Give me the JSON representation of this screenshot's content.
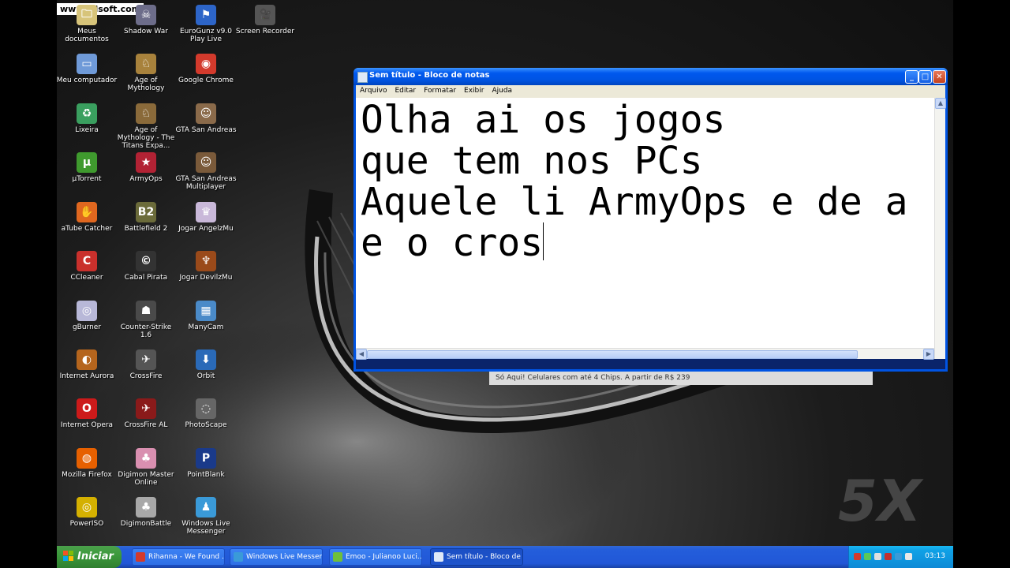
{
  "watermark": "www.zdsoft.com",
  "desktop_icons": [
    {
      "label": "Meus documentos",
      "icon": "my-documents-icon",
      "color": "#d7c47a",
      "glyph": "🗀"
    },
    {
      "label": "Shadow War",
      "icon": "shadow-war-icon",
      "color": "#6d6d8a",
      "glyph": "☠"
    },
    {
      "label": "EuroGunz v9.0 Play Live",
      "icon": "eurogunz-icon",
      "color": "#2d65c8",
      "glyph": "⚑"
    },
    {
      "label": "Screen Recorder",
      "icon": "screen-recorder-icon",
      "color": "#555555",
      "glyph": "🎥"
    },
    {
      "label": "Meu computador",
      "icon": "my-computer-icon",
      "color": "#6f9ad8",
      "glyph": "▭"
    },
    {
      "label": "Age of Mythology",
      "icon": "age-of-mythology-icon",
      "color": "#a8823c",
      "glyph": "♘"
    },
    {
      "label": "Google Chrome",
      "icon": "chrome-icon",
      "color": "#d33a2c",
      "glyph": "◉"
    },
    {
      "label": "Lixeira",
      "icon": "recycle-bin-icon",
      "color": "#3a9f5f",
      "glyph": "♻"
    },
    {
      "label": "Age of Mythology - The Titans Expa...",
      "icon": "age-of-mythology-titans-icon",
      "color": "#8a6a3a",
      "glyph": "♘"
    },
    {
      "label": "GTA San Andreas",
      "icon": "gta-sa-icon",
      "color": "#8a6a4a",
      "glyph": "☺"
    },
    {
      "label": "µTorrent",
      "icon": "utorrent-icon",
      "color": "#3f9a2e",
      "glyph": "µ"
    },
    {
      "label": "ArmyOps",
      "icon": "armyops-icon",
      "color": "#b22234",
      "glyph": "★"
    },
    {
      "label": "GTA San Andreas Multiplayer",
      "icon": "gta-samp-icon",
      "color": "#7a5a3a",
      "glyph": "☺"
    },
    {
      "label": "aTube Catcher",
      "icon": "atube-catcher-icon",
      "color": "#e0671f",
      "glyph": "✋"
    },
    {
      "label": "Battlefield 2",
      "icon": "battlefield2-icon",
      "color": "#6b6b3a",
      "glyph": "B2"
    },
    {
      "label": "Jogar AngelzMu",
      "icon": "angelzmu-icon",
      "color": "#c9b8d9",
      "glyph": "♛"
    },
    {
      "label": "CCleaner",
      "icon": "ccleaner-icon",
      "color": "#c9302c",
      "glyph": "C"
    },
    {
      "label": "Cabal Pirata",
      "icon": "cabal-icon",
      "color": "#333333",
      "glyph": "©"
    },
    {
      "label": "Jogar DevilzMu",
      "icon": "devilzmu-icon",
      "color": "#9a4a1a",
      "glyph": "♆"
    },
    {
      "label": "gBurner",
      "icon": "gburner-icon",
      "color": "#b8b8d8",
      "glyph": "◎"
    },
    {
      "label": "Counter-Strike 1.6",
      "icon": "counter-strike-icon",
      "color": "#4a4a4a",
      "glyph": "☗"
    },
    {
      "label": "ManyCam",
      "icon": "manycam-icon",
      "color": "#4a8ac8",
      "glyph": "▦"
    },
    {
      "label": "Internet Aurora",
      "icon": "internet-aurora-icon",
      "color": "#b5651d",
      "glyph": "◐"
    },
    {
      "label": "CrossFire",
      "icon": "crossfire-icon",
      "color": "#555555",
      "glyph": "✈"
    },
    {
      "label": "Orbit",
      "icon": "orbit-icon",
      "color": "#2a6ab8",
      "glyph": "⬇"
    },
    {
      "label": "Internet Opera",
      "icon": "opera-icon",
      "color": "#cc1a1a",
      "glyph": "O"
    },
    {
      "label": "CrossFire AL",
      "icon": "crossfire-al-icon",
      "color": "#8a1a1a",
      "glyph": "✈"
    },
    {
      "label": "PhotoScape",
      "icon": "photoscape-icon",
      "color": "#666666",
      "glyph": "◌"
    },
    {
      "label": "Mozilla Firefox",
      "icon": "firefox-icon",
      "color": "#e66000",
      "glyph": "◍"
    },
    {
      "label": "Digimon Master Online",
      "icon": "digimon-master-icon",
      "color": "#d98fb0",
      "glyph": "♣"
    },
    {
      "label": "PointBlank",
      "icon": "pointblank-icon",
      "color": "#1a3a8a",
      "glyph": "P"
    },
    {
      "label": "PowerISO",
      "icon": "poweriso-icon",
      "color": "#d4b000",
      "glyph": "◎"
    },
    {
      "label": "DigimonBattle",
      "icon": "digimonbattle-icon",
      "color": "#a8a8a8",
      "glyph": "♣"
    },
    {
      "label": "Windows Live Messenger",
      "icon": "msn-messenger-icon",
      "color": "#3a9ad8",
      "glyph": "♟"
    }
  ],
  "notepad": {
    "title": "Sem título - Bloco de notas",
    "menu": [
      "Arquivo",
      "Editar",
      "Formatar",
      "Exibir",
      "Ajuda"
    ],
    "lines": [
      "Olha ai os jogos",
      "que tem nos PCs",
      "Aquele li ArmyOps e de a",
      "e o cros"
    ],
    "minimize": "_",
    "maximize": "□",
    "close": "✕"
  },
  "ad_text": "Só Aqui! Celulares com até 4 Chips. A partir de R$ 239",
  "taskbar": {
    "start_label": "Iniciar",
    "tasks": [
      {
        "label": "Rihanna - We Found ...",
        "icon": "chrome-icon",
        "color": "#d33a2c"
      },
      {
        "label": "Windows Live Messen...",
        "icon": "msn-messenger-icon",
        "color": "#3a9ad8"
      },
      {
        "label": "Emoo - Julianoo Luci...",
        "icon": "msn-conversation-icon",
        "color": "#6fbf3a"
      },
      {
        "label": "Sem título - Bloco de ...",
        "icon": "notepad-icon",
        "color": "#dfe9f7"
      }
    ],
    "clock": "03:13"
  },
  "colors": {
    "taskbar": "#245edb",
    "title_bar": "#0054e3",
    "start": "#3c9a3c",
    "tray": "#0fa1e6"
  }
}
